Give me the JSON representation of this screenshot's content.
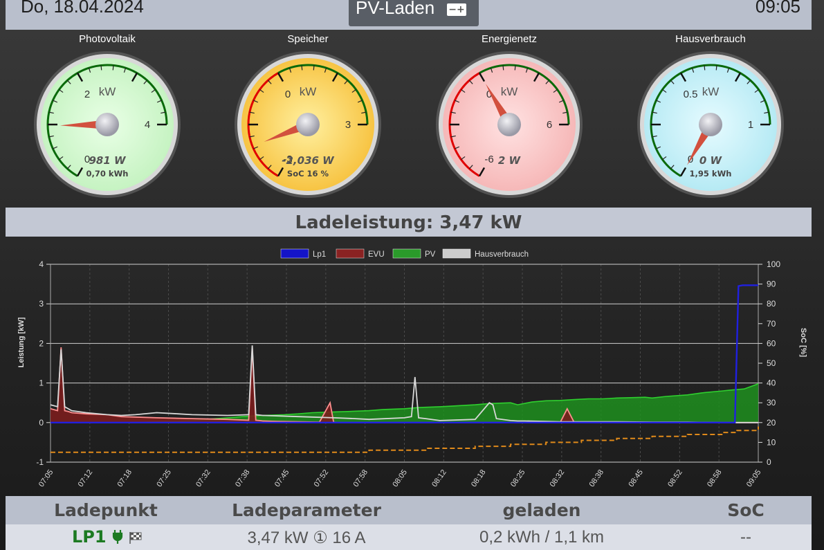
{
  "header": {
    "date": "Do, 18.04.2024",
    "time": "09:05",
    "mode": "PV-Laden",
    "mode_icon": "battery-icon"
  },
  "gauges": [
    {
      "title": "Photovoltaik",
      "unit": "kW",
      "min_label": "0",
      "mid_label": "2",
      "max_label": "4",
      "min": 0,
      "max": 4,
      "value": 0.981,
      "value_text": "981 W",
      "sub_text": "0,70 kWh",
      "face": "#c6f3c2",
      "rim": "#e9ffe6"
    },
    {
      "title": "Speicher",
      "unit": "kW",
      "min_label": "-3",
      "mid_label": "0",
      "max_label": "3",
      "min": -3,
      "max": 3,
      "value": -2.036,
      "value_text": "-2,036 W",
      "sub_text": "SoC 16 %",
      "face": "#f7c443",
      "rim": "#fff0a0"
    },
    {
      "title": "Energienetz",
      "unit": "kW",
      "min_label": "-6",
      "mid_label": "0",
      "max_label": "6",
      "min": -6,
      "max": 6,
      "value": 0.002,
      "value_text": "2 W",
      "sub_text": "",
      "face": "#f6b8b8",
      "rim": "#ffe2e2"
    },
    {
      "title": "Hausverbrauch",
      "unit": "kW",
      "min_label": "0",
      "mid_label": "0.5",
      "max_label": "1",
      "min": 0,
      "max": 1,
      "value": 0,
      "value_text": "0 W",
      "sub_text": "1,95 kWh",
      "face": "#b6eaf4",
      "rim": "#e6fbff"
    }
  ],
  "ladeleistung": "Ladeleistung: 3,47 kW",
  "chart_data": {
    "type": "line",
    "legend": [
      "Lp1",
      "EVU",
      "PV",
      "Hausverbrauch"
    ],
    "legend_colors": [
      "#1414c8",
      "#8a2222",
      "#2a9a2a",
      "#cccccc"
    ],
    "legend_position": "top",
    "ylabel": "Leistung [kW]",
    "y2label": "SoC [%]",
    "ylim": [
      -1,
      4
    ],
    "y_ticks": [
      "-1",
      "0",
      "1",
      "2",
      "3",
      "4"
    ],
    "y2lim": [
      0,
      100
    ],
    "y2_ticks": [
      "0",
      "10",
      "20",
      "30",
      "40",
      "50",
      "60",
      "70",
      "80",
      "90",
      "100"
    ],
    "x_ticks": [
      "07:05",
      "07:12",
      "07:18",
      "07:25",
      "07:32",
      "07:38",
      "07:45",
      "07:52",
      "07:58",
      "08:05",
      "08:12",
      "08:18",
      "08:25",
      "08:32",
      "08:38",
      "08:45",
      "08:52",
      "08:58",
      "09:05"
    ],
    "grid": true,
    "series": [
      {
        "name": "PV",
        "x": [
          0,
          3,
          5,
          8,
          10,
          13,
          15,
          18,
          20,
          22,
          25,
          27,
          30,
          33,
          35,
          37,
          40,
          42,
          45,
          47,
          50,
          52,
          55,
          57,
          60,
          62,
          65,
          66,
          68,
          70,
          72,
          74,
          76,
          78,
          80,
          82,
          84,
          85,
          87,
          90,
          92,
          95,
          96,
          98,
          100
        ],
        "y": [
          0,
          0,
          0,
          0,
          0,
          0.01,
          0.02,
          0.03,
          0.05,
          0.08,
          0.12,
          0.15,
          0.18,
          0.2,
          0.22,
          0.25,
          0.27,
          0.28,
          0.3,
          0.33,
          0.35,
          0.38,
          0.4,
          0.42,
          0.45,
          0.48,
          0.5,
          0.45,
          0.52,
          0.55,
          0.56,
          0.58,
          0.6,
          0.6,
          0.62,
          0.63,
          0.64,
          0.62,
          0.66,
          0.7,
          0.75,
          0.8,
          0.82,
          0.85,
          0.98
        ]
      },
      {
        "name": "EVU",
        "x": [
          0,
          1,
          1.5,
          2,
          2.5,
          3,
          5,
          8,
          10,
          15,
          20,
          25,
          28,
          28.5,
          29,
          29.5,
          30,
          32,
          35,
          38,
          39.5,
          40,
          40.5,
          42,
          50,
          72,
          73,
          74,
          100
        ],
        "y": [
          0.35,
          0.3,
          1.9,
          0.3,
          0.28,
          0.25,
          0.22,
          0.2,
          0.15,
          0.12,
          0.1,
          0.08,
          0.06,
          1.9,
          0.06,
          0.05,
          0.04,
          0.03,
          0.02,
          0.01,
          0.5,
          0.01,
          0,
          0,
          0,
          0,
          0.35,
          0,
          0
        ]
      },
      {
        "name": "Hausverbrauch",
        "x": [
          0,
          1,
          1.5,
          2,
          3,
          5,
          8,
          10,
          12,
          15,
          18,
          20,
          25,
          28,
          28.5,
          29,
          30,
          35,
          40,
          43,
          45,
          50,
          51,
          51.5,
          52,
          53,
          55,
          60,
          62,
          62.5,
          63,
          65,
          66,
          67,
          70,
          72,
          75,
          78,
          80,
          85,
          90,
          95,
          100
        ],
        "y": [
          0.45,
          0.4,
          1.85,
          0.4,
          0.3,
          0.25,
          0.2,
          0.18,
          0.2,
          0.25,
          0.22,
          0.2,
          0.18,
          0.2,
          1.95,
          0.2,
          0.18,
          0.15,
          0.12,
          0.1,
          0.08,
          0.12,
          0.15,
          1.15,
          0.12,
          0.1,
          0.05,
          0.08,
          0.5,
          0.45,
          0.1,
          0.05,
          0.04,
          0.04,
          0.03,
          0.02,
          0.02,
          0.02,
          0.02,
          0.01,
          0.01,
          0,
          0
        ]
      },
      {
        "name": "Lp1",
        "x": [
          0,
          96.7,
          97.2,
          97.8,
          100
        ],
        "y": [
          0,
          0,
          3.45,
          3.47,
          3.47
        ]
      },
      {
        "name": "SoC",
        "axis": "y2",
        "x": [
          0,
          20,
          30,
          41,
          45,
          50,
          53,
          55,
          60,
          65,
          70,
          75,
          80,
          85,
          90,
          95,
          97,
          100
        ],
        "y": [
          5,
          5,
          5,
          5,
          6,
          6,
          7,
          7,
          8,
          9,
          10,
          11,
          12,
          13,
          14,
          15,
          16,
          18
        ]
      }
    ]
  },
  "table": {
    "headers": [
      "Ladepunkt",
      "Ladeparameter",
      "geladen",
      "SoC"
    ],
    "row": {
      "ladepunkt": "LP1",
      "ladepunkt_icons": [
        "plug-icon",
        "flag-icon"
      ],
      "ladeparameter": "3,47 kW ① 16 A",
      "geladen": "0,2 kWh / 1,1 km",
      "soc": "--"
    }
  }
}
